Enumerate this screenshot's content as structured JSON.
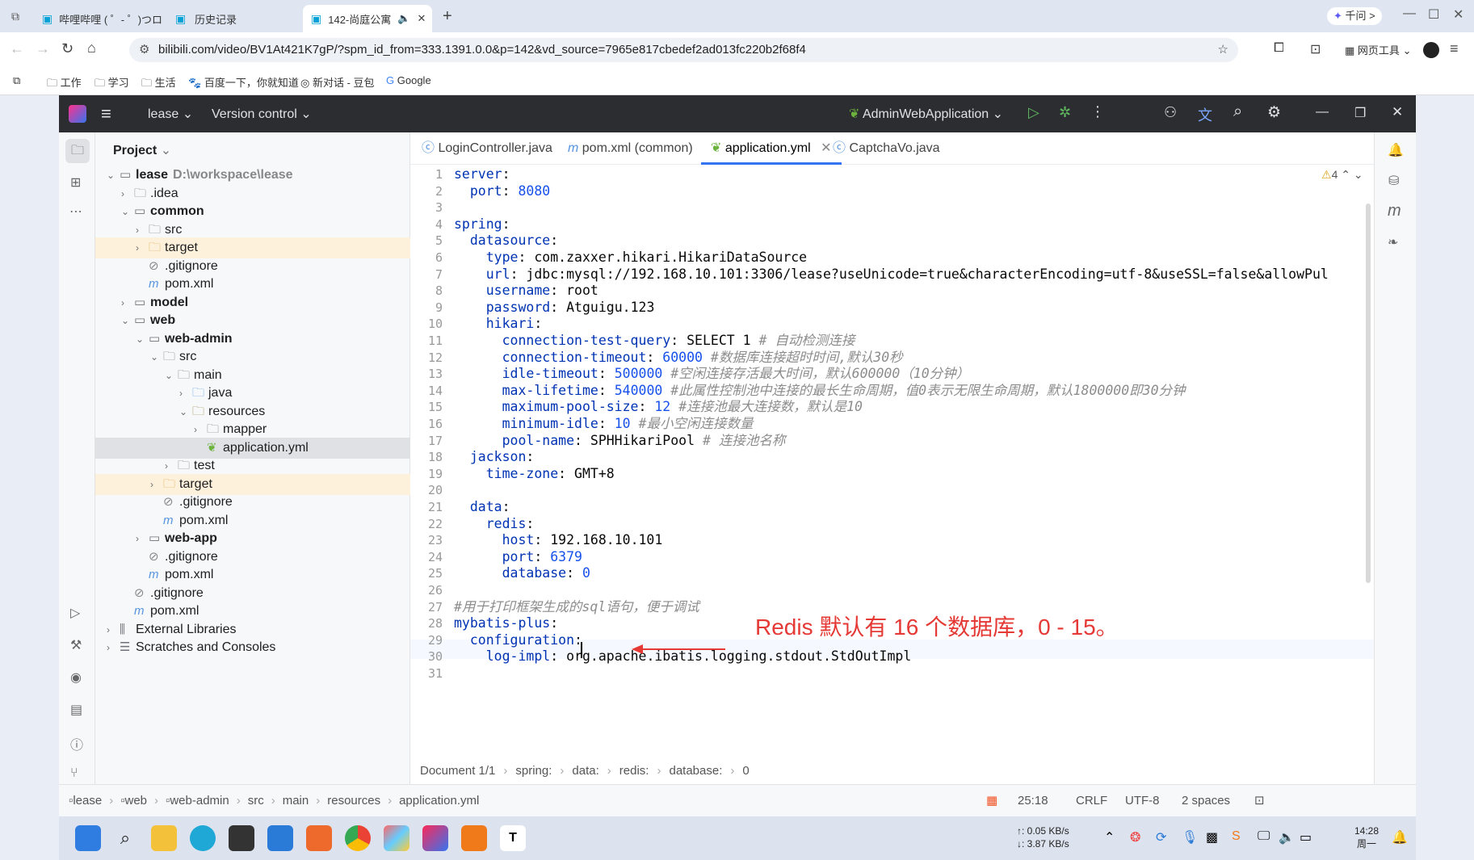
{
  "browser": {
    "tabs": [
      {
        "label": "哔哩哔哩 ( ゜- ゜)つロ"
      },
      {
        "label": "历史记录"
      },
      {
        "label": "142-尚庭公寓"
      }
    ],
    "qianwen": "千问 >",
    "url": "bilibili.com/video/BV1At421K7gP/?spm_id_from=333.1391.0.0&p=142&vd_source=7965e817cbedef2ad013fc220b2f68f4",
    "web_tools": "网页工具",
    "bookmarks": [
      "工作",
      "学习",
      "生活",
      "百度一下，你就知道",
      "新对话 - 豆包",
      "Google"
    ]
  },
  "ide": {
    "project_name": "lease",
    "version_control": "Version control",
    "run_config": "AdminWebApplication",
    "panel_title": "Project",
    "tree": [
      {
        "label": "lease",
        "extra": "D:\\workspace\\lease",
        "depth": 0,
        "chev": "v",
        "icon": "module",
        "bold": true
      },
      {
        "label": ".idea",
        "depth": 1,
        "chev": ">",
        "icon": "folder"
      },
      {
        "label": "common",
        "depth": 1,
        "chev": "v",
        "icon": "module",
        "bold": true
      },
      {
        "label": "src",
        "depth": 2,
        "chev": ">",
        "icon": "folder"
      },
      {
        "label": "target",
        "depth": 2,
        "chev": ">",
        "icon": "folder-o",
        "hl": true
      },
      {
        "label": ".gitignore",
        "depth": 2,
        "chev": "",
        "icon": "ignore"
      },
      {
        "label": "pom.xml",
        "depth": 2,
        "chev": "",
        "icon": "maven"
      },
      {
        "label": "model",
        "depth": 1,
        "chev": ">",
        "icon": "module",
        "bold": true
      },
      {
        "label": "web",
        "depth": 1,
        "chev": "v",
        "icon": "module",
        "bold": true
      },
      {
        "label": "web-admin",
        "depth": 2,
        "chev": "v",
        "icon": "module",
        "bold": true
      },
      {
        "label": "src",
        "depth": 3,
        "chev": "v",
        "icon": "folder"
      },
      {
        "label": "main",
        "depth": 4,
        "chev": "v",
        "icon": "folder"
      },
      {
        "label": "java",
        "depth": 5,
        "chev": ">",
        "icon": "folder-b"
      },
      {
        "label": "resources",
        "depth": 5,
        "chev": "v",
        "icon": "folder-r"
      },
      {
        "label": "mapper",
        "depth": 6,
        "chev": ">",
        "icon": "folder"
      },
      {
        "label": "application.yml",
        "depth": 6,
        "chev": "",
        "icon": "yml",
        "sel": true
      },
      {
        "label": "test",
        "depth": 4,
        "chev": ">",
        "icon": "folder"
      },
      {
        "label": "target",
        "depth": 3,
        "chev": ">",
        "icon": "folder-o",
        "hl": true
      },
      {
        "label": ".gitignore",
        "depth": 3,
        "chev": "",
        "icon": "ignore"
      },
      {
        "label": "pom.xml",
        "depth": 3,
        "chev": "",
        "icon": "maven"
      },
      {
        "label": "web-app",
        "depth": 2,
        "chev": ">",
        "icon": "module",
        "bold": true
      },
      {
        "label": ".gitignore",
        "depth": 2,
        "chev": "",
        "icon": "ignore"
      },
      {
        "label": "pom.xml",
        "depth": 2,
        "chev": "",
        "icon": "maven"
      },
      {
        "label": ".gitignore",
        "depth": 1,
        "chev": "",
        "icon": "ignore"
      },
      {
        "label": "pom.xml",
        "depth": 1,
        "chev": "",
        "icon": "maven"
      },
      {
        "label": "External Libraries",
        "depth": 0,
        "chev": ">",
        "icon": "lib"
      },
      {
        "label": "Scratches and Consoles",
        "depth": 0,
        "chev": ">",
        "icon": "scratch"
      }
    ],
    "editor_tabs": [
      {
        "label": "LoginController.java",
        "active": false
      },
      {
        "label": "pom.xml (common)",
        "active": false
      },
      {
        "label": "application.yml",
        "active": true
      },
      {
        "label": "CaptchaVo.java",
        "active": false
      }
    ],
    "warnings": "4",
    "code_lines": [
      [
        [
          "k",
          "server"
        ],
        [
          "v",
          ":"
        ]
      ],
      [
        [
          "v",
          "  "
        ],
        [
          "k",
          "port"
        ],
        [
          "v",
          ": "
        ],
        [
          "n",
          "8080"
        ]
      ],
      [],
      [
        [
          "k",
          "spring"
        ],
        [
          "v",
          ":"
        ]
      ],
      [
        [
          "v",
          "  "
        ],
        [
          "k",
          "datasource"
        ],
        [
          "v",
          ":"
        ]
      ],
      [
        [
          "v",
          "    "
        ],
        [
          "k",
          "type"
        ],
        [
          "v",
          ": com.zaxxer.hikari.HikariDataSource"
        ]
      ],
      [
        [
          "v",
          "    "
        ],
        [
          "k",
          "url"
        ],
        [
          "v",
          ": jdbc:mysql://192.168.10.101:3306/lease?useUnicode=true&characterEncoding=utf-8&useSSL=false&allowPul"
        ]
      ],
      [
        [
          "v",
          "    "
        ],
        [
          "k",
          "username"
        ],
        [
          "v",
          ": root"
        ]
      ],
      [
        [
          "v",
          "    "
        ],
        [
          "k",
          "password"
        ],
        [
          "v",
          ": Atguigu.123"
        ]
      ],
      [
        [
          "v",
          "    "
        ],
        [
          "k",
          "hikari"
        ],
        [
          "v",
          ":"
        ]
      ],
      [
        [
          "v",
          "      "
        ],
        [
          "k",
          "connection-test-query"
        ],
        [
          "v",
          ": SELECT 1 "
        ],
        [
          "c",
          "# 自动检测连接"
        ]
      ],
      [
        [
          "v",
          "      "
        ],
        [
          "k",
          "connection-timeout"
        ],
        [
          "v",
          ": "
        ],
        [
          "n",
          "60000"
        ],
        [
          "v",
          " "
        ],
        [
          "c",
          "#数据库连接超时时间,默认30秒"
        ]
      ],
      [
        [
          "v",
          "      "
        ],
        [
          "k",
          "idle-timeout"
        ],
        [
          "v",
          ": "
        ],
        [
          "n",
          "500000"
        ],
        [
          "v",
          " "
        ],
        [
          "c",
          "#空闲连接存活最大时间，默认600000（10分钟）"
        ]
      ],
      [
        [
          "v",
          "      "
        ],
        [
          "k",
          "max-lifetime"
        ],
        [
          "v",
          ": "
        ],
        [
          "n",
          "540000"
        ],
        [
          "v",
          " "
        ],
        [
          "c",
          "#此属性控制池中连接的最长生命周期，值0表示无限生命周期，默认1800000即30分钟"
        ]
      ],
      [
        [
          "v",
          "      "
        ],
        [
          "k",
          "maximum-pool-size"
        ],
        [
          "v",
          ": "
        ],
        [
          "n",
          "12"
        ],
        [
          "v",
          " "
        ],
        [
          "c",
          "#连接池最大连接数，默认是10"
        ]
      ],
      [
        [
          "v",
          "      "
        ],
        [
          "k",
          "minimum-idle"
        ],
        [
          "v",
          ": "
        ],
        [
          "n",
          "10"
        ],
        [
          "v",
          " "
        ],
        [
          "c",
          "#最小空闲连接数量"
        ]
      ],
      [
        [
          "v",
          "      "
        ],
        [
          "k",
          "pool-name"
        ],
        [
          "v",
          ": SPHHikariPool "
        ],
        [
          "c",
          "# 连接池名称"
        ]
      ],
      [
        [
          "v",
          "  "
        ],
        [
          "k",
          "jackson"
        ],
        [
          "v",
          ":"
        ]
      ],
      [
        [
          "v",
          "    "
        ],
        [
          "k",
          "time-zone"
        ],
        [
          "v",
          ": GMT+8"
        ]
      ],
      [],
      [
        [
          "v",
          "  "
        ],
        [
          "k",
          "data"
        ],
        [
          "v",
          ":"
        ]
      ],
      [
        [
          "v",
          "    "
        ],
        [
          "k",
          "redis"
        ],
        [
          "v",
          ":"
        ]
      ],
      [
        [
          "v",
          "      "
        ],
        [
          "k",
          "host"
        ],
        [
          "v",
          ": 192.168.10.101"
        ]
      ],
      [
        [
          "v",
          "      "
        ],
        [
          "k",
          "port"
        ],
        [
          "v",
          ": "
        ],
        [
          "n",
          "6379"
        ]
      ],
      [
        [
          "v",
          "      "
        ],
        [
          "k",
          "database"
        ],
        [
          "v",
          ": "
        ],
        [
          "n",
          "0"
        ]
      ],
      [],
      [
        [
          "c",
          "#用于打印框架生成的sql语句，便于调试"
        ]
      ],
      [
        [
          "k",
          "mybatis-plus"
        ],
        [
          "v",
          ":"
        ]
      ],
      [
        [
          "v",
          "  "
        ],
        [
          "k",
          "configuration"
        ],
        [
          "v",
          ":"
        ]
      ],
      [
        [
          "v",
          "    "
        ],
        [
          "k",
          "log-impl"
        ],
        [
          "v",
          ": org.apache.ibatis.logging.stdout.StdOutImpl"
        ]
      ],
      []
    ],
    "editor_crumbs": [
      "Document 1/1",
      "spring:",
      "data:",
      "redis:",
      "database:",
      "0"
    ],
    "bottom_path": [
      "lease",
      "web",
      "web-admin",
      "src",
      "main",
      "resources",
      "application.yml"
    ],
    "bottom_status": {
      "pos": "25:18",
      "eol": "CRLF",
      "enc": "UTF-8",
      "indent": "2 spaces"
    }
  },
  "annotation": "Redis 默认有 16 个数据库，0 - 15。",
  "taskbar": {
    "net_up": "↑: 0.05 KB/s",
    "net_down": "↓: 3.87 KB/s",
    "time": "14:28",
    "day": "周一"
  }
}
